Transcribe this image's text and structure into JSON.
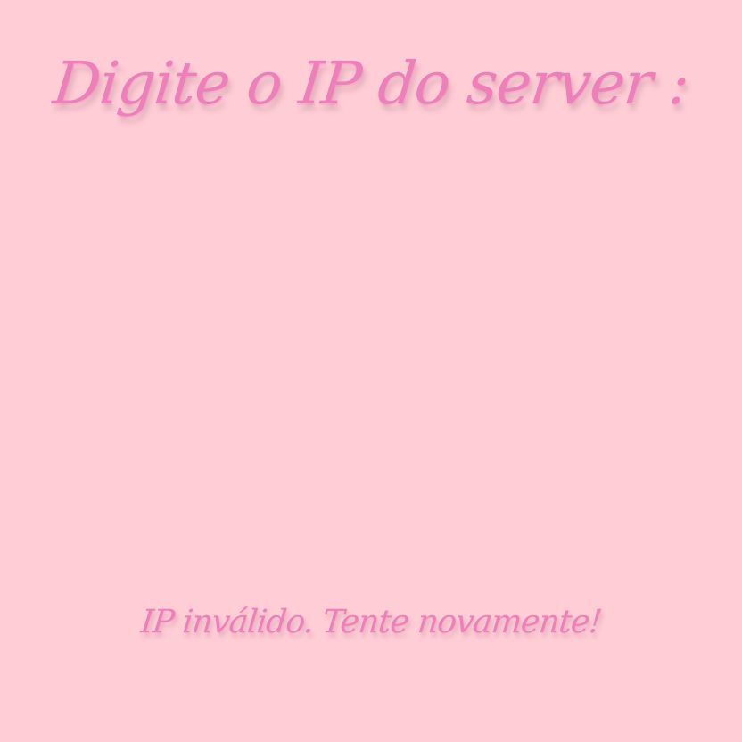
{
  "screen": {
    "prompt": "Digite o IP do server :",
    "error": "IP inválido. Tente novamente!"
  },
  "colors": {
    "background": "#ffcdd6",
    "text": "#ee7fba"
  }
}
